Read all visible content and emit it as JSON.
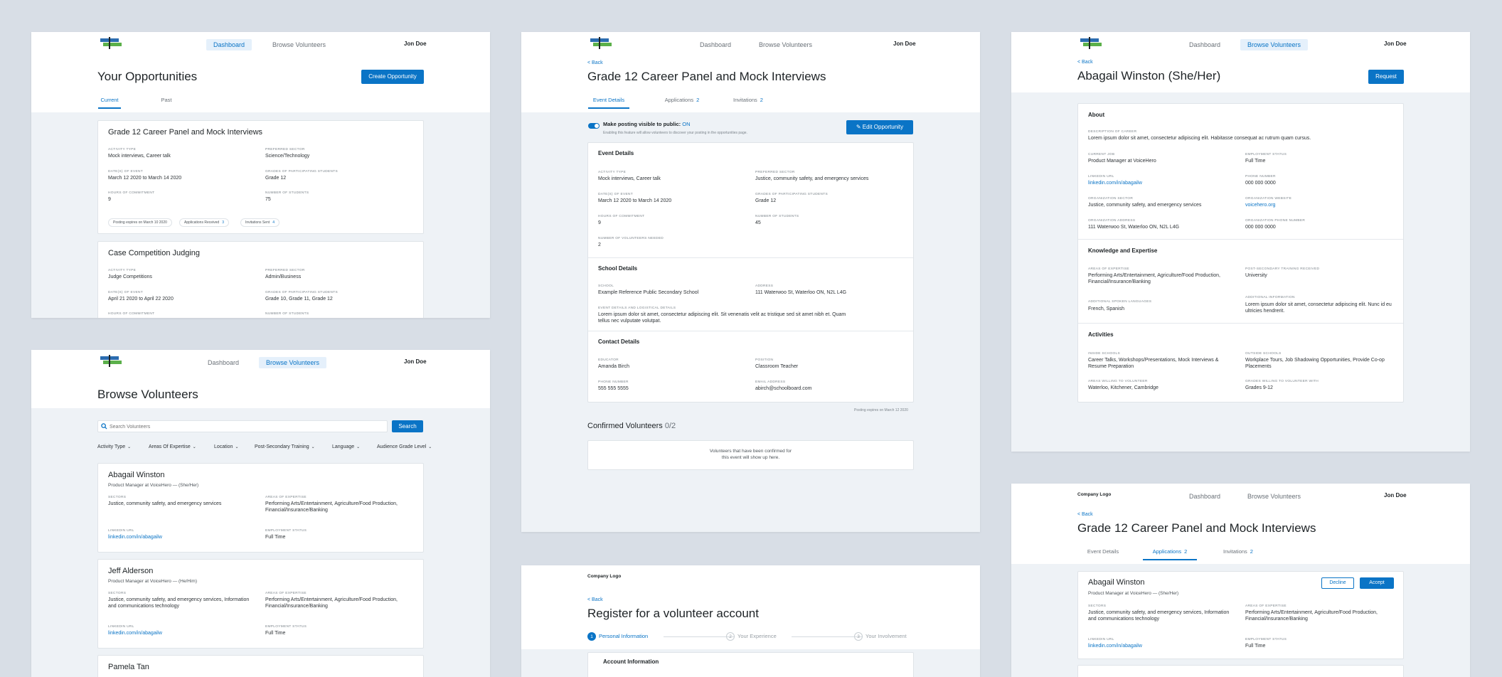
{
  "colors": {
    "accent": "#0a74c6",
    "background": "#eef2f6",
    "canvas": "#d8dee6"
  },
  "common": {
    "dashboard": "Dashboard",
    "browse": "Browse Volunteers",
    "user": "Jon Doe",
    "back": "< Back",
    "company_logo": "Company Logo",
    "logo_icon": "flag-logo-icon"
  },
  "p1": {
    "title": "Your Opportunities",
    "create_btn": "Create Opportunity",
    "tabs": [
      "Current",
      "Past"
    ],
    "cards": [
      {
        "title": "Grade 12 Career Panel and Mock Interviews",
        "fields": [
          {
            "label": "Activity Type",
            "value": "Mock interviews, Career talk"
          },
          {
            "label": "Preferred Sector",
            "value": "Science/Technology"
          },
          {
            "label": "Date(s) of Event",
            "value": "March 12 2020 to March 14 2020"
          },
          {
            "label": "Grades of Participating Students",
            "value": "Grade 12"
          },
          {
            "label": "Hours of Commitment",
            "value": "9"
          },
          {
            "label": "Number of Students",
            "value": "75"
          }
        ],
        "chips": [
          {
            "text": "Posting expires on March 10 2020",
            "n": ""
          },
          {
            "text": "Applications Received",
            "n": "3"
          },
          {
            "text": "Invitations Sent",
            "n": "4"
          }
        ]
      },
      {
        "title": "Case Competition Judging",
        "fields": [
          {
            "label": "Activity Type",
            "value": "Judge Competitions"
          },
          {
            "label": "Preferred Sector",
            "value": "Admin/Business"
          },
          {
            "label": "Date(s) of Event",
            "value": "April 21 2020 to April 22 2020"
          },
          {
            "label": "Grades of Participating Students",
            "value": "Grade 10, Grade 11, Grade 12"
          },
          {
            "label": "Hours of Commitment",
            "value": ""
          },
          {
            "label": "Number of Students",
            "value": ""
          }
        ]
      }
    ]
  },
  "p2": {
    "title": "Browse Volunteers",
    "search_placeholder": "Search Volunteers",
    "search_btn": "Search",
    "filters": [
      "Activity Type",
      "Areas Of Expertise",
      "Location",
      "Post-Secondary Training",
      "Language",
      "Audience Grade Level"
    ],
    "vols": [
      {
        "name": "Abagail Winston",
        "role": "Product Manager at VoiceHero — (She/Her)",
        "sectors": "Justice, community safety, and emergency services",
        "expertise": "Performing Arts/Entertainment, Agriculture/Food Production, Financial/Insurance/Banking",
        "linkedin": "linkedin.com/in/abagailw",
        "status": "Full Time"
      },
      {
        "name": "Jeff Alderson",
        "role": "Product Manager at VoiceHero — (He/Him)",
        "sectors": "Justice, community safety, and emergency services, Information and communications technology",
        "expertise": "Performing Arts/Entertainment, Agriculture/Food Production, Financial/Insurance/Banking",
        "linkedin": "linkedin.com/in/abagailw",
        "status": "Full Time"
      },
      {
        "name": "Pamela Tan"
      }
    ],
    "labels": {
      "sectors": "Sectors",
      "expertise": "Areas of Expertise",
      "linkedin": "LinkedIn URL",
      "status": "Employment Status"
    }
  },
  "p3": {
    "title": "Grade 12 Career Panel and Mock Interviews",
    "tabs": [
      {
        "label": "Event Details",
        "n": ""
      },
      {
        "label": "Applications",
        "n": "2"
      },
      {
        "label": "Invitations",
        "n": "2"
      }
    ],
    "toggle_label": "Make posting visible to public:",
    "toggle_state": "ON",
    "toggle_sub": "Enabling this feature will allow volunteers to discover your posting in the opportunities page.",
    "edit_btn": "Edit Opportunity",
    "event_title": "Event Details",
    "event": [
      {
        "label": "Activity Type",
        "value": "Mock interviews, Career talk"
      },
      {
        "label": "Preferred Sector",
        "value": "Justice, community safety, and emergency services"
      },
      {
        "label": "Date(s) of Event",
        "value": "March 12 2020 to March 14 2020"
      },
      {
        "label": "Grades of Participating Students",
        "value": "Grade 12"
      },
      {
        "label": "Hours of Commitment",
        "value": "9"
      },
      {
        "label": "Number of Students",
        "value": "45"
      },
      {
        "label": "Number of Volunteers Needed",
        "value": "2"
      }
    ],
    "school_title": "School Details",
    "school": [
      {
        "label": "School",
        "value": "Example Reference Public Secondary School"
      },
      {
        "label": "Address",
        "value": "111 Waterwoo St, Waterloo ON, N2L L4G"
      },
      {
        "label": "Event Details and Logistical Details",
        "value": "Lorem ipsum dolor sit amet, consectetur adipiscing elit. Sit venenatis velit ac tristique sed sit amet nibh et. Quam tellus nec vulputate volutpat."
      }
    ],
    "contact_title": "Contact Details",
    "contact": [
      {
        "label": "Educator",
        "value": "Amanda Birch"
      },
      {
        "label": "Position",
        "value": "Classroom Teacher"
      },
      {
        "label": "Phone Number",
        "value": "555 555 5555"
      },
      {
        "label": "Email Address",
        "value": "abirch@schoolboard.com"
      }
    ],
    "expires": "Posting expires on March 12 2020",
    "confirmed_title": "Confirmed Volunteers",
    "confirmed_count": "0/2",
    "confirmed_empty_1": "Volunteers that have been confirmed for",
    "confirmed_empty_2": "this event will show up here."
  },
  "p4": {
    "title": "Register for a volunteer account",
    "steps": [
      {
        "n": "1",
        "label": "Personal Information"
      },
      {
        "n": "2",
        "label": "Your Experience"
      },
      {
        "n": "3",
        "label": "Your Involvement"
      }
    ],
    "section": "Account Information"
  },
  "p5": {
    "title": "Abagail Winston (She/Her)",
    "request_btn": "Request",
    "about_title": "About",
    "desc_label": "Description of Career",
    "desc": "Lorem ipsum dolor sit amet, consectetur adipiscing elit. Habitasse consequat ac rutrum quam cursus.",
    "about": [
      {
        "label": "Current Job",
        "value": "Product Manager at VoiceHero",
        "link": false
      },
      {
        "label": "Employment Status",
        "value": "Full Time",
        "link": false
      },
      {
        "label": "LinkedIn URL",
        "value": "linkedin.com/in/abagailw",
        "link": true
      },
      {
        "label": "Phone Number",
        "value": "000 000 0000",
        "link": false
      },
      {
        "label": "Organization Sector",
        "value": "Justice, community safety, and emergency services",
        "link": false
      },
      {
        "label": "Organization Website",
        "value": "voicehero.org",
        "link": true
      },
      {
        "label": "Organization Address",
        "value": "111 Waterwoo St, Waterloo ON, N2L L4G",
        "link": false
      },
      {
        "label": "Organization Phone Number",
        "value": "000 000 0000",
        "link": false
      }
    ],
    "know_title": "Knowledge and Expertise",
    "know": [
      {
        "label": "Areas of Expertise",
        "value": "Performing Arts/Entertainment, Agriculture/Food Production, Financial/Insurance/Banking"
      },
      {
        "label": "Post-Secondary Training Received",
        "value": "University"
      },
      {
        "label": "Additional Spoken Languages",
        "value": "French, Spanish"
      },
      {
        "label": "Additional Information",
        "value": "Lorem ipsum dolor sit amet, consectetur adipiscing elit. Nunc id eu ultricies hendrerit."
      }
    ],
    "act_title": "Activities",
    "acts": [
      {
        "label": "Inside Schools",
        "value": "Career Talks, Workshops/Presentations, Mock Interviews & Resume Preparation"
      },
      {
        "label": "Outside Schools",
        "value": "Workplace Tours, Job Shadowing Opportunities, Provide Co-op Placements"
      },
      {
        "label": "Areas Willing to Volunteer",
        "value": "Waterloo, Kitchener, Cambridge"
      },
      {
        "label": "Grades Willing to Volunteer With",
        "value": "Grades 9-12"
      }
    ]
  },
  "p6": {
    "title": "Grade 12 Career Panel and Mock Interviews",
    "tabs": [
      {
        "label": "Event Details",
        "n": ""
      },
      {
        "label": "Applications",
        "n": "2"
      },
      {
        "label": "Invitations",
        "n": "2"
      }
    ],
    "decline": "Decline",
    "accept": "Accept",
    "app": {
      "name": "Abagail Winston",
      "role": "Product Manager at VoiceHero — (She/Her)",
      "sectors": "Justice, community safety, and emergency services, Information and communications technology",
      "expertise": "Performing Arts/Entertainment, Agriculture/Food Production, Financial/Insurance/Banking",
      "linkedin": "linkedin.com/in/abagailw",
      "status": "Full Time"
    }
  }
}
